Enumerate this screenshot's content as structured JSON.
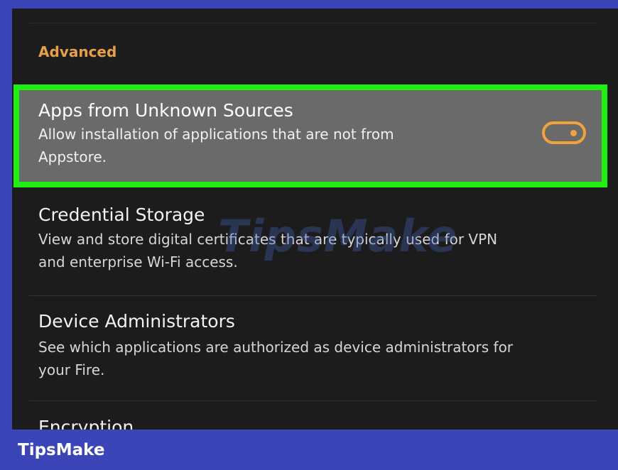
{
  "section": {
    "title": "Advanced"
  },
  "settings": [
    {
      "title": "Apps from Unknown Sources",
      "description_line1": "Allow installation of applications that are not from",
      "description_line2": "Appstore.",
      "toggle_on": true
    },
    {
      "title": "Credential Storage",
      "description_line1": "View and store digital certificates that are typically used for VPN",
      "description_line2": "and enterprise Wi-Fi access."
    },
    {
      "title": "Device Administrators",
      "description_line1": "See which applications are authorized as device administrators for",
      "description_line2": "your Fire."
    },
    {
      "title": "Encryption"
    }
  ],
  "watermark": "TipsMake",
  "footer": {
    "brand": "TipsMake"
  },
  "colors": {
    "highlight_border": "#1ff012",
    "accent": "#e6a04a",
    "toggle": "#f0a23c",
    "frame": "#3c45b8"
  }
}
